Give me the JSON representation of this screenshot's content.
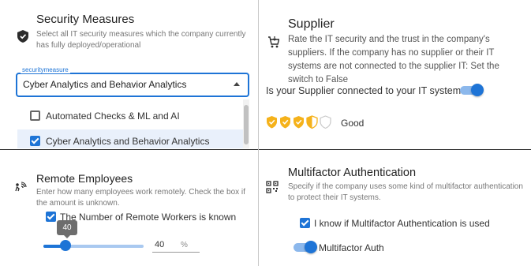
{
  "security": {
    "title": "Security Measures",
    "description": "Select all IT security measures which the company currently has fully deployed/operational",
    "select_label": "securitymeasure",
    "select_value": "Cyber Analytics and Behavior Analytics",
    "options": [
      {
        "label": "Automated Checks & ML and AI",
        "checked": false
      },
      {
        "label": "Cyber Analytics and Behavior Analytics",
        "checked": true
      }
    ],
    "icon": "shield-check-icon"
  },
  "supplier": {
    "title": "Supplier",
    "description": "Rate the IT security and the trust in the company's suppliers. If the company has no supplier or their IT systems are not connected to the supplier IT: Set the switch to False",
    "question": "Is your Supplier connected to your IT systems?",
    "connected": true,
    "rating": 3.5,
    "rating_max": 5,
    "rating_label": "Good",
    "icon": "cart-icon",
    "rating_color": "#f5b21b"
  },
  "remote": {
    "title": "Remote Employees",
    "description": "Enter how many employees work remotely. Check the box if the amount is unknown.",
    "known_label": "The Number of Remote Workers is known",
    "known_checked": true,
    "slider_value": 40,
    "slider_tooltip": "40",
    "input_value": "40",
    "unit": "%",
    "icon": "wifi-person-icon"
  },
  "mfa": {
    "title": "Multifactor Authentication",
    "description": "Specify if the company uses some kind of multifactor authentication to protect their IT systems.",
    "know_label": "I know if Multifactor Authentication is used",
    "know_checked": true,
    "toggle_label": "Multifactor Auth",
    "toggle_on": true,
    "icon": "qr-code-icon"
  },
  "colors": {
    "accent": "#1e74d6",
    "star": "#f5b21b"
  }
}
